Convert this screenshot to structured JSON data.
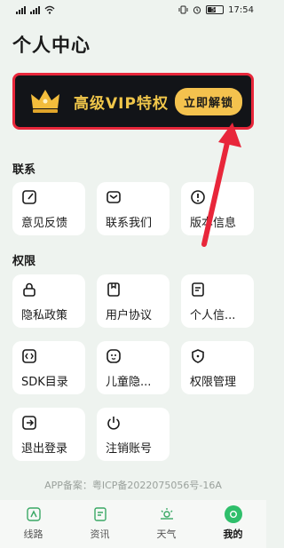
{
  "status_bar": {
    "time": "17:54",
    "battery": "56"
  },
  "page_title": "个人中心",
  "vip": {
    "title": "高级VIP特权",
    "button": "立即解锁"
  },
  "sections": {
    "contact": {
      "label": "联系",
      "items": [
        {
          "label": "意见反馈",
          "icon": "edit-icon"
        },
        {
          "label": "联系我们",
          "icon": "mail-icon"
        },
        {
          "label": "版本信息",
          "icon": "info-icon"
        }
      ]
    },
    "permissions": {
      "label": "权限",
      "items": [
        {
          "label": "隐私政策",
          "icon": "lock-icon"
        },
        {
          "label": "用户协议",
          "icon": "document-icon"
        },
        {
          "label": "个人信...",
          "icon": "profile-doc-icon"
        },
        {
          "label": "SDK目录",
          "icon": "code-icon"
        },
        {
          "label": "儿童隐...",
          "icon": "child-face-icon"
        },
        {
          "label": "权限管理",
          "icon": "shield-icon"
        },
        {
          "label": "退出登录",
          "icon": "logout-icon"
        },
        {
          "label": "注销账号",
          "icon": "power-icon"
        }
      ]
    }
  },
  "icp": "APP备案：粤ICP备2022075056号-16A",
  "tabs": [
    {
      "label": "线路",
      "icon": "route-icon"
    },
    {
      "label": "资讯",
      "icon": "news-icon"
    },
    {
      "label": "天气",
      "icon": "weather-icon"
    },
    {
      "label": "我的",
      "icon": "profile-icon"
    }
  ],
  "colors": {
    "accent": "#2fbf6b",
    "vip_gold": "#f0c64a",
    "highlight_red": "#e8263a"
  }
}
